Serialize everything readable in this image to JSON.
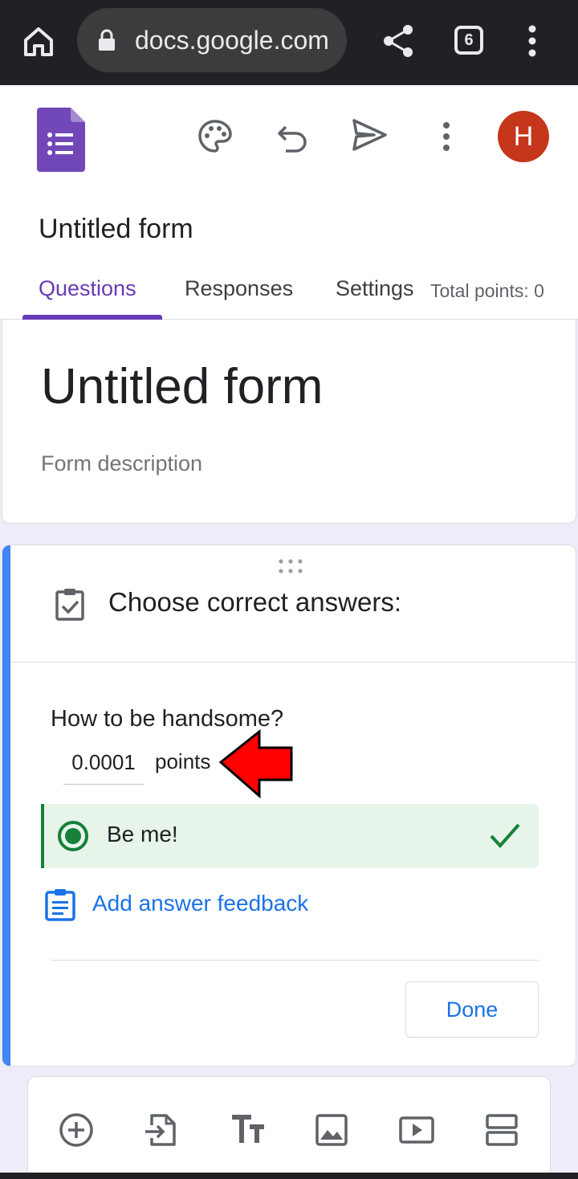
{
  "browser": {
    "url": "docs.google.com",
    "tab_count": "6"
  },
  "header": {
    "doc_title": "Untitled form",
    "avatar_letter": "H",
    "tabs": [
      {
        "label": "Questions"
      },
      {
        "label": "Responses"
      },
      {
        "label": "Settings"
      }
    ],
    "total_points": "Total points: 0"
  },
  "form": {
    "title": "Untitled form",
    "description_placeholder": "Form description"
  },
  "question_card": {
    "heading": "Choose correct answers:",
    "question": "How to be handsome?",
    "points_value": "0.0001",
    "points_label": "points",
    "option": {
      "label": "Be me!",
      "correct": true
    },
    "feedback_link": "Add answer feedback",
    "done_label": "Done"
  },
  "toolbar": {
    "icons": [
      "add-question-icon",
      "import-questions-icon",
      "add-title-icon",
      "add-image-icon",
      "add-video-icon",
      "add-section-icon"
    ]
  },
  "colors": {
    "brand": "#673ab7",
    "accent": "#1a73e8",
    "correct": "#188038",
    "avatar": "#c5361b",
    "annotation_arrow": "#ff0000"
  }
}
